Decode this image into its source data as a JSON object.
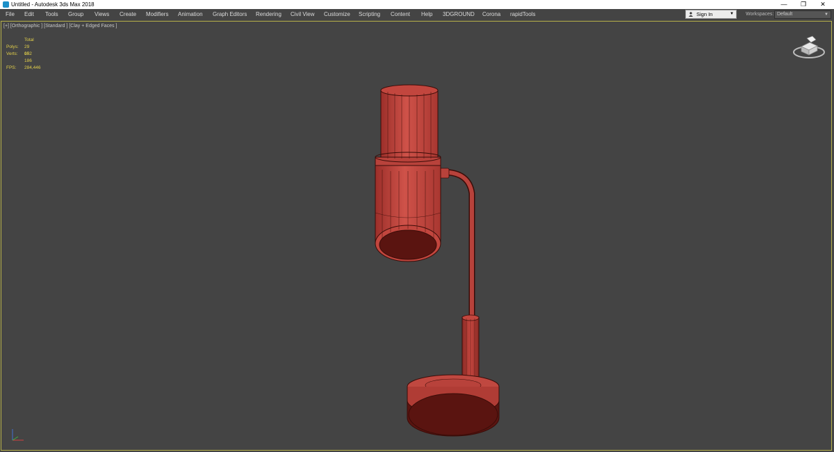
{
  "window": {
    "title": "Untitled - Autodesk 3ds Max 2018",
    "minimize_glyph": "—",
    "restore_glyph": "❐",
    "close_glyph": "✕"
  },
  "menu": {
    "items": [
      "File",
      "Edit",
      "Tools",
      "Group",
      "Views",
      "Create",
      "Modifiers",
      "Animation",
      "Graph Editors",
      "Rendering",
      "Civil View",
      "Customize",
      "Scripting",
      "Content",
      "Help",
      "3DGROUND",
      "Corona",
      "rapidTools"
    ],
    "signin_label": "Sign In",
    "workspaces_label": "Workspaces:",
    "workspace_value": "Default"
  },
  "viewport": {
    "label": "[+] [Orthographic ] [Standard ] [Clay + Edged Faces ]",
    "stats": {
      "header": "Total",
      "polys_label": "Polys:",
      "polys_value": "29 002",
      "verts_label": "Verts:",
      "verts_value": "15 186",
      "fps_label": "FPS:",
      "fps_value": "284,446"
    },
    "axis": {
      "x": "x",
      "y": "y",
      "z": "z"
    }
  },
  "colors": {
    "viewport_bg": "#444444",
    "lamp_fill": "#c0443e",
    "lamp_dark": "#5a1410",
    "wire": "#3a0c08",
    "stats_text": "#e3d04a",
    "viewport_border": "#b8b24a"
  },
  "icons": {
    "app": "3ds-max-icon",
    "user": "user-icon",
    "viewcube": "viewcube-icon",
    "axis": "axis-tripod-icon"
  }
}
